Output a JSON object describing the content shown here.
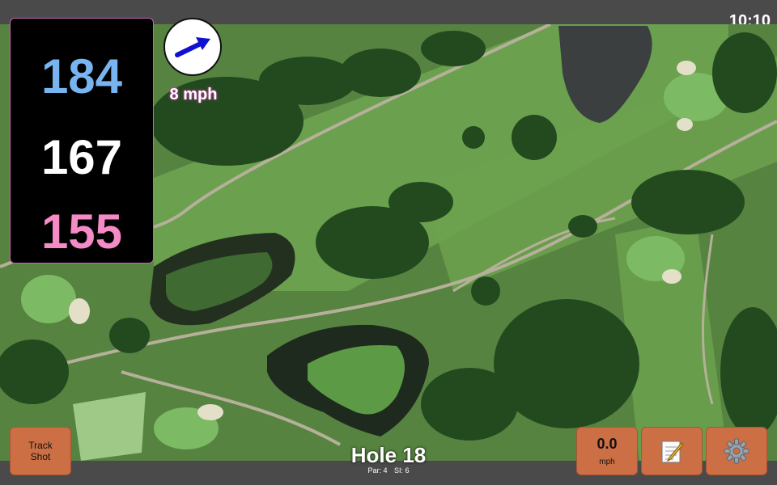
{
  "status": {
    "time": "10:10"
  },
  "distances": {
    "back": "184",
    "middle": "167",
    "front": "155"
  },
  "wind": {
    "speed": "8 mph",
    "icon": "wind-direction-arrow-icon"
  },
  "buttons": {
    "track_shot_line1": "Track",
    "track_shot_line2": "Shot",
    "speed_value": "0.0",
    "speed_unit": "mph",
    "notes_icon": "notepad-icon",
    "settings_icon": "gear-icon"
  },
  "hole": {
    "title": "Hole 18",
    "par": "Par: 4",
    "si": "SI: 6"
  },
  "colors": {
    "back_distance": "#78b4f0",
    "middle_distance": "#ffffff",
    "front_distance": "#f48ac6",
    "button_bg": "#cd6f44",
    "wind_arrow": "#1010d0"
  }
}
